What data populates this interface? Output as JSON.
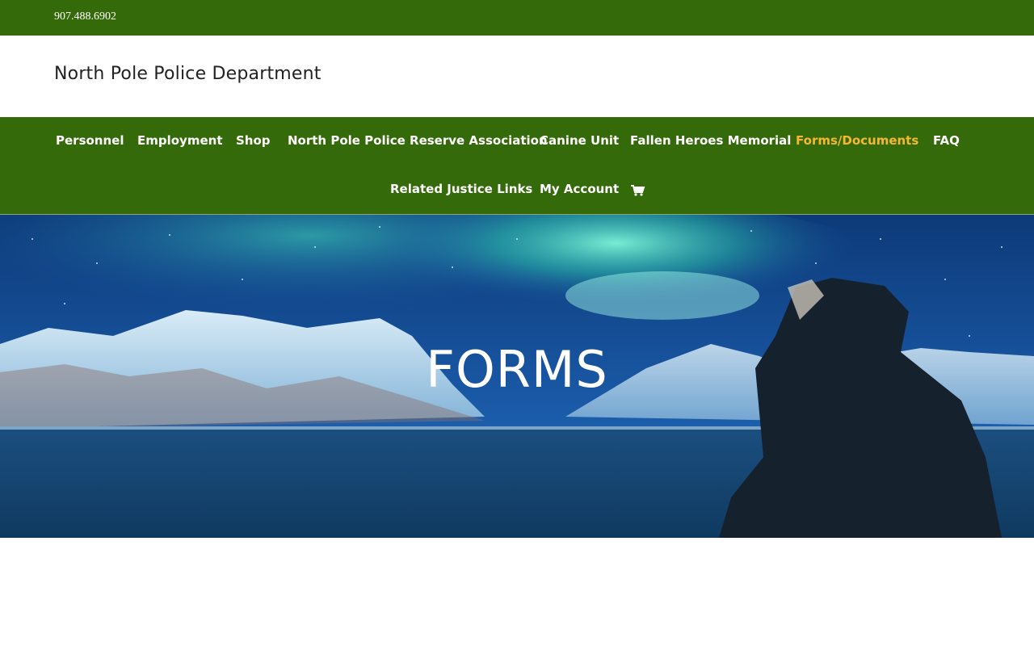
{
  "topbar": {
    "phone": "907.488.6902"
  },
  "header": {
    "site_title": "North Pole Police Department"
  },
  "nav": {
    "items": [
      {
        "label": "Personnel"
      },
      {
        "label": "Employment"
      },
      {
        "label": "Shop"
      },
      {
        "label": "North Pole Police Reserve Association"
      },
      {
        "label": "Canine Unit"
      },
      {
        "label": "Fallen Heroes Memorial"
      },
      {
        "label": "Forms/Documents",
        "active": true
      },
      {
        "label": "FAQ"
      },
      {
        "label": "Related Justice Links"
      },
      {
        "label": "My Account"
      }
    ],
    "cart_icon": "shopping-cart-icon"
  },
  "hero": {
    "title": "FORMS",
    "image": "aurora-over-mountains-with-person-in-parka"
  },
  "colors": {
    "brand_green": "#356a0a",
    "active_link": "#f5b82e",
    "text_dark": "#222222"
  }
}
